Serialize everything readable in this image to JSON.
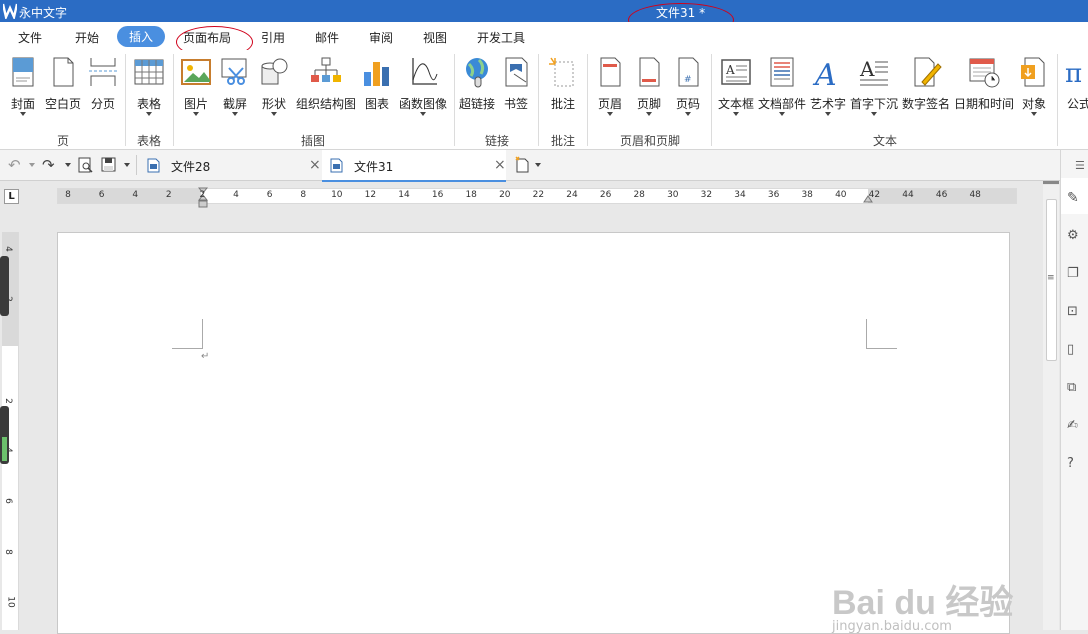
{
  "window": {
    "app_name": "永中文字",
    "doc_title": "文件31 *"
  },
  "menu": [
    {
      "label": "文件",
      "active": false
    },
    {
      "label": "开始",
      "active": false
    },
    {
      "label": "插入",
      "active": true
    },
    {
      "label": "页面布局",
      "active": false
    },
    {
      "label": "引用",
      "active": false
    },
    {
      "label": "邮件",
      "active": false
    },
    {
      "label": "审阅",
      "active": false
    },
    {
      "label": "视图",
      "active": false
    },
    {
      "label": "开发工具",
      "active": false
    }
  ],
  "ribbon": {
    "buttons": [
      {
        "label": "封面",
        "icon": "cover-icon"
      },
      {
        "label": "空白页",
        "icon": "blank-page-icon"
      },
      {
        "label": "分页",
        "icon": "page-break-icon"
      },
      {
        "label": "表格",
        "icon": "table-icon"
      },
      {
        "label": "图片",
        "icon": "picture-icon"
      },
      {
        "label": "截屏",
        "icon": "screenshot-icon"
      },
      {
        "label": "形状",
        "icon": "shapes-icon"
      },
      {
        "label": "组织结构图",
        "icon": "org-chart-icon"
      },
      {
        "label": "图表",
        "icon": "chart-icon"
      },
      {
        "label": "函数图像",
        "icon": "function-graph-icon"
      },
      {
        "label": "超链接",
        "icon": "hyperlink-icon"
      },
      {
        "label": "书签",
        "icon": "bookmark-icon"
      },
      {
        "label": "批注",
        "icon": "comment-icon"
      },
      {
        "label": "页眉",
        "icon": "header-icon"
      },
      {
        "label": "页脚",
        "icon": "footer-icon"
      },
      {
        "label": "页码",
        "icon": "page-number-icon"
      },
      {
        "label": "文本框",
        "icon": "textbox-icon"
      },
      {
        "label": "文档部件",
        "icon": "doc-parts-icon"
      },
      {
        "label": "艺术字",
        "icon": "wordart-icon"
      },
      {
        "label": "首字下沉",
        "icon": "drop-cap-icon"
      },
      {
        "label": "数字签名",
        "icon": "digital-signature-icon"
      },
      {
        "label": "日期和时间",
        "icon": "date-time-icon"
      },
      {
        "label": "对象",
        "icon": "object-icon"
      },
      {
        "label": "公式",
        "icon": "formula-icon"
      }
    ],
    "groups": [
      "页",
      "表格",
      "插图",
      "链接",
      "批注",
      "页眉和页脚",
      "文本"
    ]
  },
  "tabs": [
    {
      "label": "文件28"
    },
    {
      "label": "文件31"
    }
  ],
  "ruler": {
    "h_labels": [
      "8",
      "6",
      "4",
      "2",
      "2",
      "4",
      "6",
      "8",
      "10",
      "12",
      "14",
      "16",
      "18",
      "20",
      "22",
      "24",
      "26",
      "28",
      "30",
      "32",
      "34",
      "36",
      "38",
      "40",
      "42",
      "44",
      "46",
      "48"
    ],
    "v_labels": [
      "4",
      "2",
      "2",
      "4",
      "6",
      "8",
      "10"
    ]
  },
  "watermark": {
    "brand": "Bai du 经验",
    "url": "jingyan.baidu.com"
  },
  "colors": {
    "titlebar": "#2b6cc4",
    "active_menu": "#4a8fe0",
    "annotation": "#d0021b"
  }
}
